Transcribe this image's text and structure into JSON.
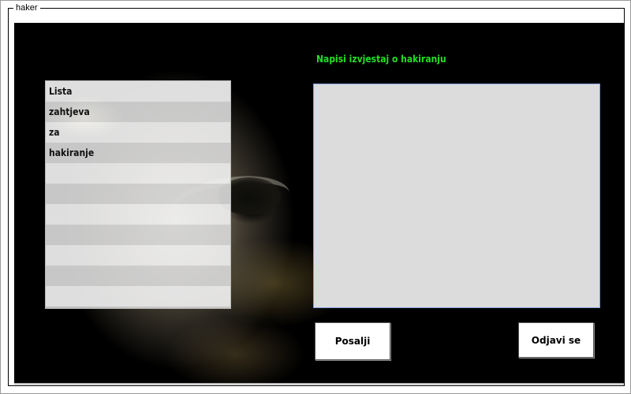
{
  "window": {
    "group_title": "haker"
  },
  "requests": {
    "items": [
      "Lista",
      "zahtjeva",
      "za",
      "hakiranje",
      "",
      "",
      "",
      "",
      "",
      "",
      ""
    ]
  },
  "report": {
    "label": "Napisi izvjestaj o hakiranju",
    "value": ""
  },
  "buttons": {
    "send_label": "Posalji",
    "logout_label": "Odjavi se"
  },
  "colors": {
    "label_green": "#22e022",
    "panel_background": "#000000"
  }
}
